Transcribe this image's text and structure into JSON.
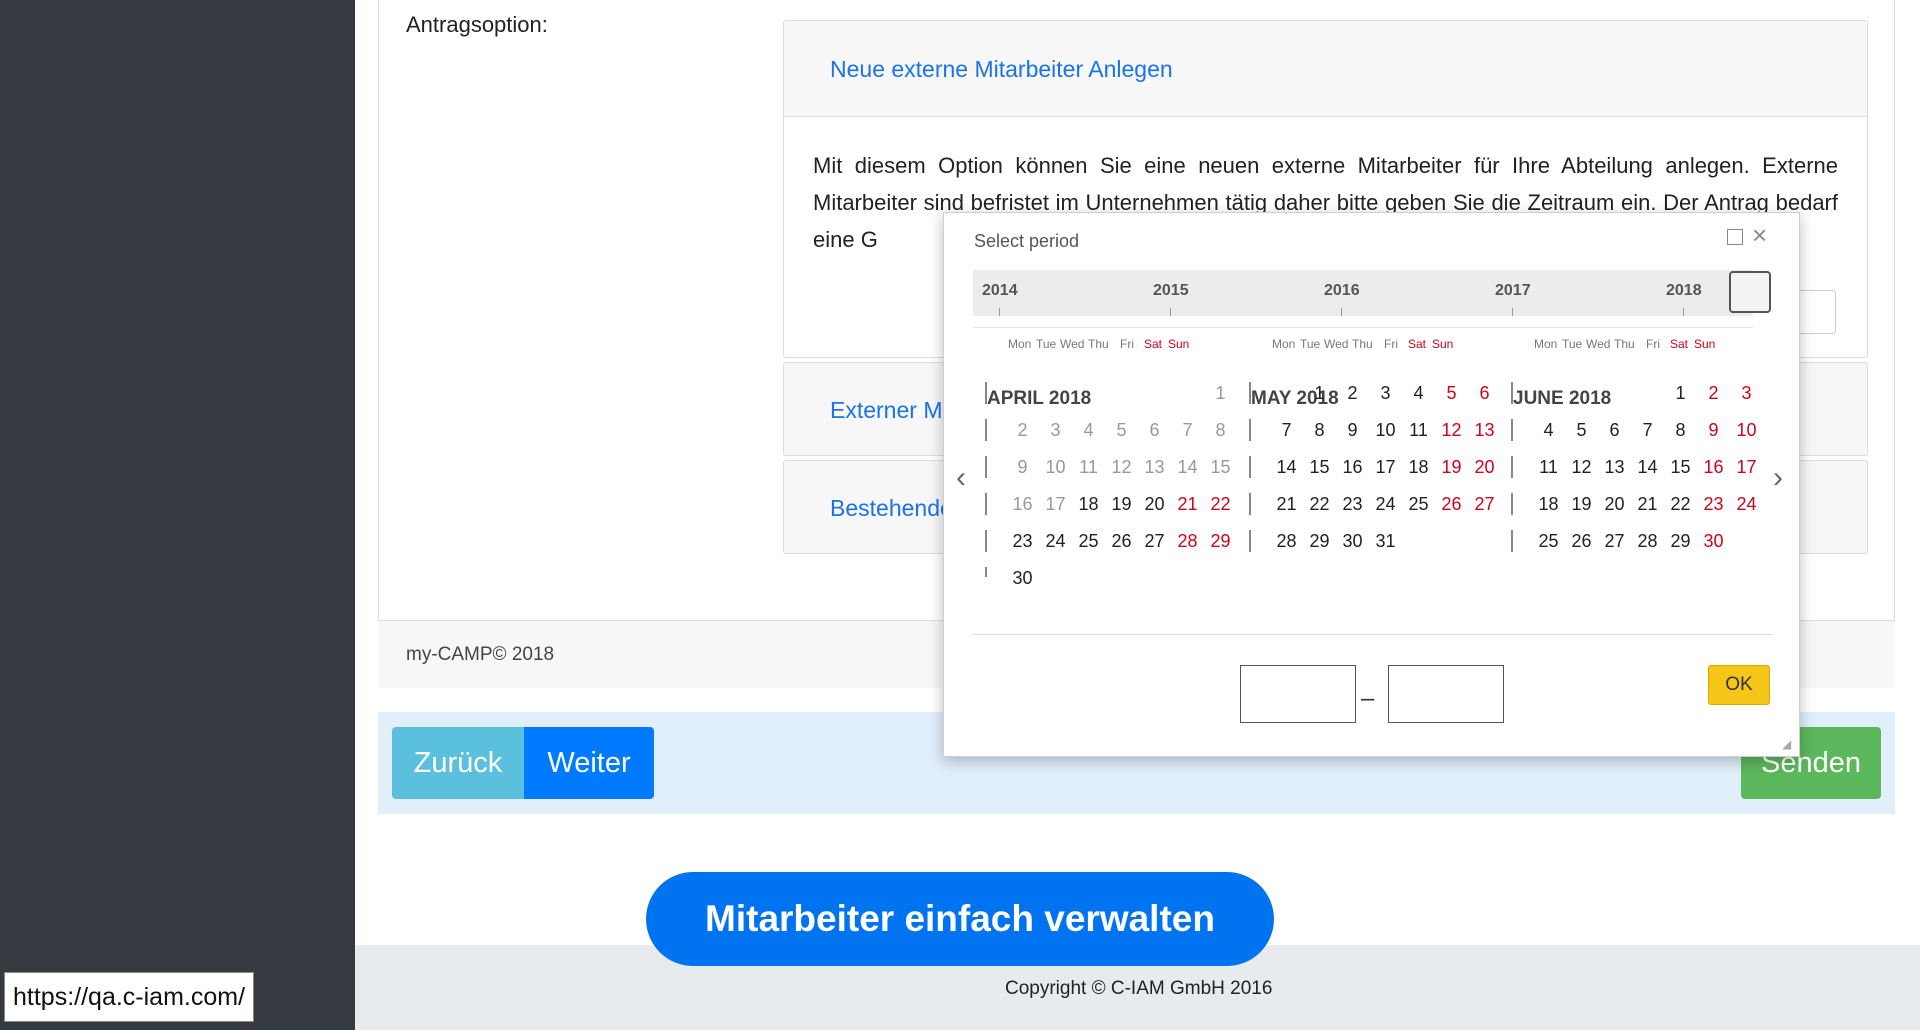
{
  "sidebar": {
    "url_tooltip": "https://qa.c-iam.com/"
  },
  "form": {
    "label": "Antragsoption:",
    "option1_title": "Neue externe Mitarbeiter Anlegen",
    "option1_text": "Mit diesem Option können Sie eine neuen externe Mitarbeiter für Ihre Abteilung anlegen. Externe Mitarbeiter sind befristet im Unternehmen tätig daher bitte geben Sie die Zeitraum ein. Der Antrag bedarf eine G",
    "option2_title": "Externer M",
    "option3_title": "Bestehende"
  },
  "card_footer": "my-CAMP© 2018",
  "nav": {
    "back": "Zurück",
    "next": "Weiter",
    "send": "Senden"
  },
  "banner": "Mitarbeiter einfach verwalten",
  "copyright": "Copyright © C-IAM GmbH 2016",
  "picker": {
    "title": "Select period",
    "years": [
      "2014",
      "2015",
      "2016",
      "2017",
      "2018"
    ],
    "weekdays": [
      "Mon",
      "Tue",
      "Wed",
      "Thu",
      "Fri",
      "Sat",
      "Sun"
    ],
    "months": [
      {
        "title": "APRIL 2018",
        "weeks": [
          [
            "",
            "",
            "",
            "",
            "",
            "",
            "1"
          ],
          [
            "2",
            "3",
            "4",
            "5",
            "6",
            "7",
            "8"
          ],
          [
            "9",
            "10",
            "11",
            "12",
            "13",
            "14",
            "15"
          ],
          [
            "16",
            "17",
            "18",
            "19",
            "20",
            "21",
            "22"
          ],
          [
            "23",
            "24",
            "25",
            "26",
            "27",
            "28",
            "29"
          ],
          [
            "30",
            "",
            "",
            "",
            "",
            "",
            ""
          ]
        ]
      },
      {
        "title": "MAY 2018",
        "weeks": [
          [
            "",
            "1",
            "2",
            "3",
            "4",
            "5",
            "6"
          ],
          [
            "7",
            "8",
            "9",
            "10",
            "11",
            "12",
            "13"
          ],
          [
            "14",
            "15",
            "16",
            "17",
            "18",
            "19",
            "20"
          ],
          [
            "21",
            "22",
            "23",
            "24",
            "25",
            "26",
            "27"
          ],
          [
            "28",
            "29",
            "30",
            "31",
            "",
            "",
            ""
          ]
        ]
      },
      {
        "title": "JUNE 2018",
        "weeks": [
          [
            "",
            "",
            "",
            "",
            "1",
            "2",
            "3"
          ],
          [
            "4",
            "5",
            "6",
            "7",
            "8",
            "9",
            "10"
          ],
          [
            "11",
            "12",
            "13",
            "14",
            "15",
            "16",
            "17"
          ],
          [
            "18",
            "19",
            "20",
            "21",
            "22",
            "23",
            "24"
          ],
          [
            "25",
            "26",
            "27",
            "28",
            "29",
            "30",
            ""
          ]
        ]
      }
    ],
    "range_start": "",
    "range_end": "",
    "ok": "OK",
    "colors": {
      "weekend": "#d0021b",
      "muted": "#999999",
      "ok_button": "#f5c518"
    }
  }
}
